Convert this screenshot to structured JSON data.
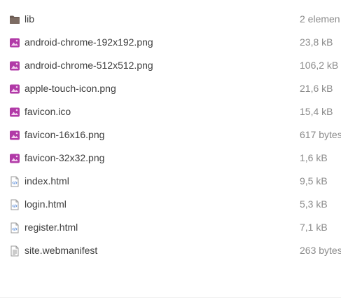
{
  "colors": {
    "folder": "#6a5a52",
    "image_icon": "#b13aa7",
    "html_icon": "#5b8dd9",
    "text_icon": "#9a9a9a",
    "name_text": "#3d3d3d",
    "size_text": "#8b8b8b"
  },
  "files": [
    {
      "name": "lib",
      "size": "2 elemen",
      "icon": "folder-icon"
    },
    {
      "name": "android-chrome-192x192.png",
      "size": "23,8 kB",
      "icon": "image-icon"
    },
    {
      "name": "android-chrome-512x512.png",
      "size": "106,2 kB",
      "icon": "image-icon"
    },
    {
      "name": "apple-touch-icon.png",
      "size": "21,6 kB",
      "icon": "image-icon"
    },
    {
      "name": "favicon.ico",
      "size": "15,4 kB",
      "icon": "image-icon"
    },
    {
      "name": "favicon-16x16.png",
      "size": "617 bytes",
      "icon": "image-icon"
    },
    {
      "name": "favicon-32x32.png",
      "size": "1,6 kB",
      "icon": "image-icon"
    },
    {
      "name": "index.html",
      "size": "9,5 kB",
      "icon": "html-file-icon"
    },
    {
      "name": "login.html",
      "size": "5,3 kB",
      "icon": "html-file-icon"
    },
    {
      "name": "register.html",
      "size": "7,1 kB",
      "icon": "html-file-icon"
    },
    {
      "name": "site.webmanifest",
      "size": "263 bytes",
      "icon": "text-file-icon"
    }
  ]
}
